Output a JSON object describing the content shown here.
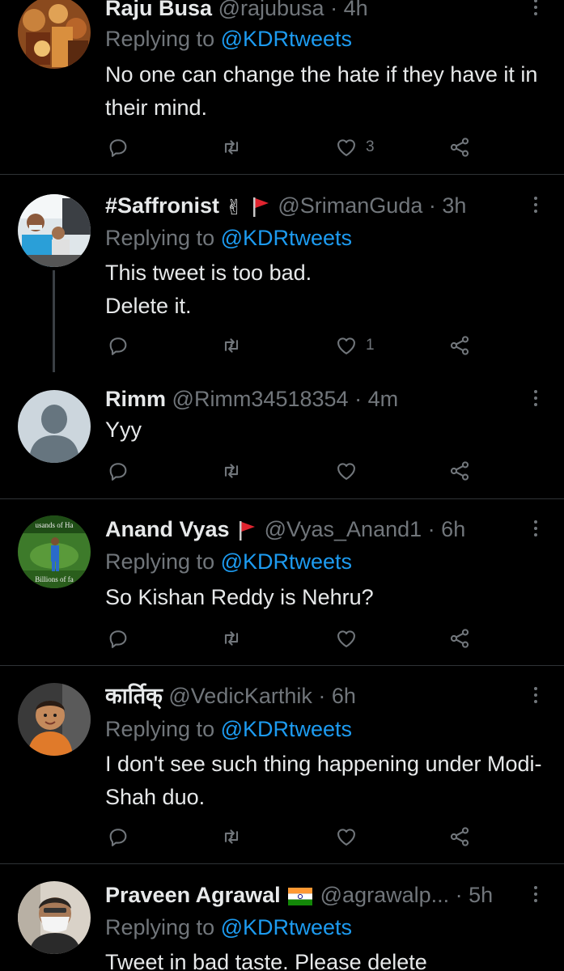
{
  "colors": {
    "background": "#000000",
    "text": "#e7e9ea",
    "secondary": "#71767b",
    "link": "#1d9bf0",
    "divider": "#2f3336"
  },
  "tweets": [
    {
      "name": "Raju Busa",
      "handle": "@rajubusa",
      "time": "4h",
      "replying_prefix": "Replying to",
      "replying_to": "@KDRtweets",
      "text": "No one can change the hate if they have it in their mind.",
      "likes": "3",
      "avatar": "painting-avatar"
    },
    {
      "name": "#Saffronist",
      "name_icons": [
        "victory-hand-icon",
        "red-flag-icon"
      ],
      "handle": "@SrimanGuda",
      "time": "3h",
      "replying_prefix": "Replying to",
      "replying_to": "@KDRtweets",
      "text_lines": [
        "This tweet is too bad.",
        "Delete it."
      ],
      "likes": "1",
      "avatar": "car-photo-avatar"
    },
    {
      "name": "Rimm",
      "handle": "@Rimm34518354",
      "time": "4m",
      "text": "Yyy",
      "avatar": "default-avatar"
    },
    {
      "name": "Anand Vyas",
      "name_icons": [
        "red-flag-icon"
      ],
      "handle": "@Vyas_Anand1",
      "time": "6h",
      "replying_prefix": "Replying to",
      "replying_to": "@KDRtweets",
      "text": "So Kishan Reddy is Nehru?",
      "avatar": "cricket-avatar",
      "avatar_text_top": "usands of Ha",
      "avatar_text_bottom": "Billions of fa"
    },
    {
      "name": "कार्तिक्",
      "handle": "@VedicKarthik",
      "time": "6h",
      "replying_prefix": "Replying to",
      "replying_to": "@KDRtweets",
      "text": "I don't see such thing happening under Modi-Shah duo.",
      "avatar": "child-photo-avatar"
    },
    {
      "name": "Praveen Agrawal",
      "name_icons": [
        "india-flag-icon"
      ],
      "handle": "@agrawalp...",
      "time": "5h",
      "replying_prefix": "Replying to",
      "replying_to": "@KDRtweets",
      "text": "Tweet in bad taste. Please delete",
      "avatar": "masked-man-avatar"
    }
  ]
}
